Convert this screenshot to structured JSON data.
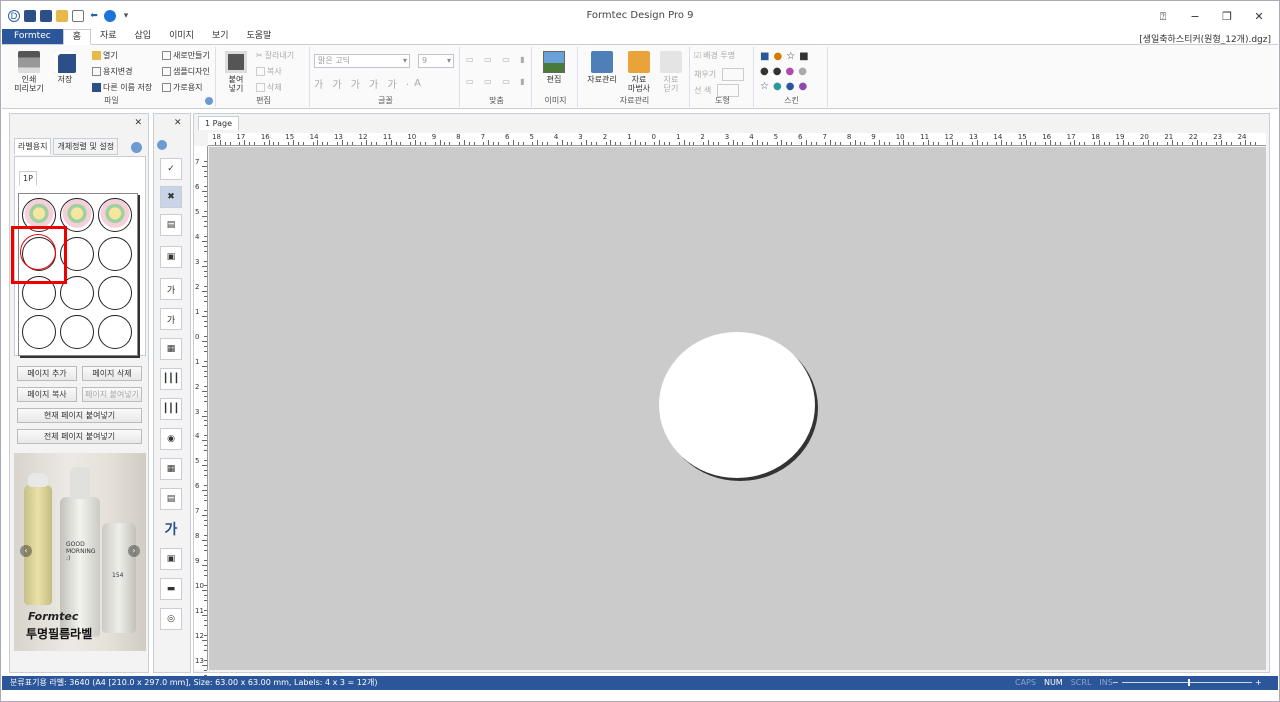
{
  "window": {
    "title": "Formtec Design Pro 9",
    "file_path": "[생일축하스티커(원형_12개).dgz]"
  },
  "tabs": [
    "Formtec",
    "홈",
    "자료",
    "삽입",
    "이미지",
    "보기",
    "도움말"
  ],
  "ribbon": {
    "print": "인쇄\n미리보기",
    "save": "저장",
    "open": "열기",
    "paper_change": "용지변경",
    "save_as": "다른 이름 저장",
    "new": "새로만들기",
    "sample": "샘플디자인",
    "landscape": "가로용지",
    "group_file": "파일",
    "paste": "붙여\n넣기",
    "cut": "잘라내기",
    "copy": "복사",
    "delete": "삭제",
    "group_edit": "편집",
    "font_name": "맑은 고딕",
    "font_size": "9",
    "group_font": "글꼴",
    "group_align": "맞춤",
    "edit_image": "편집",
    "group_image": "이미지",
    "data_manage": "자료관리",
    "data_wizard": "자료\n마법사",
    "data_close": "자료\n닫기",
    "group_data": "자료관리",
    "bg_transparent": "배경 투명",
    "fill": "채우기",
    "line": "선  색",
    "group_shape": "도형",
    "group_skin": "스킨"
  },
  "left_panel": {
    "tab_label_paper": "라벨용지",
    "tab_arrange": "개체정렬 및 설정",
    "page_tab": "1P",
    "btn_add_page": "페이지 추가",
    "btn_delete_page": "페이지 삭제",
    "btn_copy_page": "페이지 복사",
    "btn_paste_page": "페이지 붙여넣기",
    "btn_paste_current": "현재 페이지 붙여넣기",
    "btn_paste_all": "전체 페이지 붙여넣기",
    "ad_brand": "Formtec",
    "ad_text": "투명필름라벨",
    "ad_bottle_text": "GOOD\nMORNING\n:)",
    "ad_number": "154"
  },
  "canvas": {
    "page_tab": "1 Page",
    "hruler_labels": [
      "18",
      "17",
      "16",
      "15",
      "14",
      "13",
      "12",
      "11",
      "10",
      "9",
      "8",
      "7",
      "6",
      "5",
      "4",
      "3",
      "2",
      "1",
      "0",
      "1",
      "2",
      "3",
      "4",
      "5",
      "6",
      "7",
      "8",
      "9",
      "10",
      "11",
      "12",
      "13",
      "14",
      "15",
      "16",
      "17",
      "18",
      "19",
      "20",
      "21",
      "22",
      "23",
      "24"
    ],
    "vruler_labels": [
      "7",
      "6",
      "5",
      "4",
      "3",
      "2",
      "1",
      "0",
      "1",
      "2",
      "3",
      "4",
      "5",
      "6",
      "7",
      "8",
      "9",
      "10",
      "11",
      "12",
      "13"
    ]
  },
  "status": {
    "text": "분류표기용 라벨: 3640 (A4 [210.0 x 297.0 mm], Size: 63.00 x 63.00 mm,  Labels: 4 x 3 = 12개)",
    "caps": "CAPS",
    "num": "NUM",
    "scrl": "SCRL",
    "ins": "INS",
    "zoom_minus": "−",
    "zoom_plus": "+"
  }
}
